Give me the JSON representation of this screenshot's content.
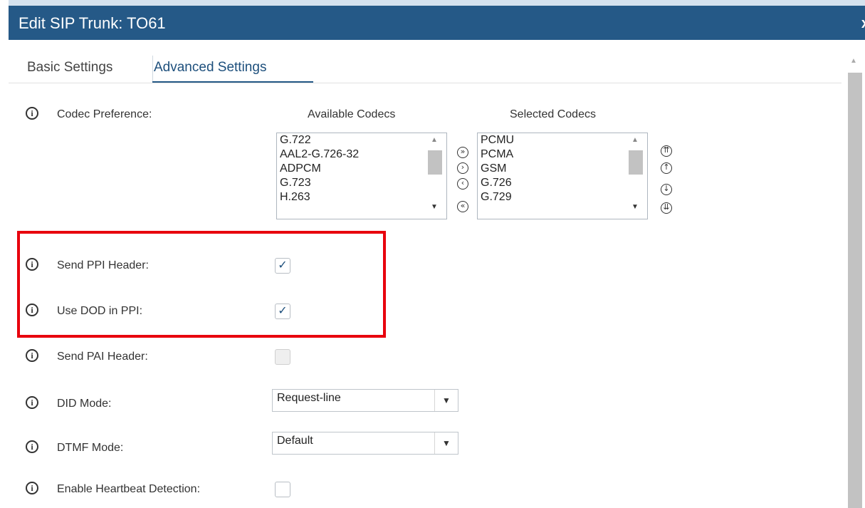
{
  "dialog": {
    "title": "Edit SIP Trunk: TO61",
    "close": "x"
  },
  "tabs": [
    {
      "label": "Basic Settings",
      "active": false
    },
    {
      "label": "Advanced Settings",
      "active": true
    }
  ],
  "codec": {
    "label": "Codec Preference:",
    "available_header": "Available Codecs",
    "selected_header": "Selected Codecs",
    "available": [
      "G.722",
      "AAL2-G.726-32",
      "ADPCM",
      "G.723",
      "H.263"
    ],
    "selected": [
      "PCMU",
      "PCMA",
      "GSM",
      "G.726",
      "G.729"
    ],
    "move_buttons": [
      "move-all-right",
      "move-right",
      "move-left",
      "move-all-left"
    ],
    "order_buttons": [
      "move-top",
      "move-up",
      "move-down",
      "move-bottom"
    ]
  },
  "fields": {
    "send_ppi": {
      "label": "Send PPI Header:",
      "checked": true,
      "mark": "✓"
    },
    "use_dod_ppi": {
      "label": "Use DOD in PPI:",
      "checked": true,
      "mark": "✓"
    },
    "send_pai": {
      "label": "Send PAI Header:",
      "checked": false,
      "disabled": true
    },
    "did_mode": {
      "label": "DID Mode:",
      "value": "Request-line"
    },
    "dtmf_mode": {
      "label": "DTMF Mode:",
      "value": "Default"
    },
    "heartbeat": {
      "label": "Enable Heartbeat Detection:",
      "checked": false
    }
  },
  "icons": {
    "info": "info-icon",
    "dropdown": "▼",
    "info_glyph": "i"
  },
  "colors": {
    "title_bar": "#255987",
    "highlight": "#e8000d",
    "check": "#1d4f7c"
  }
}
